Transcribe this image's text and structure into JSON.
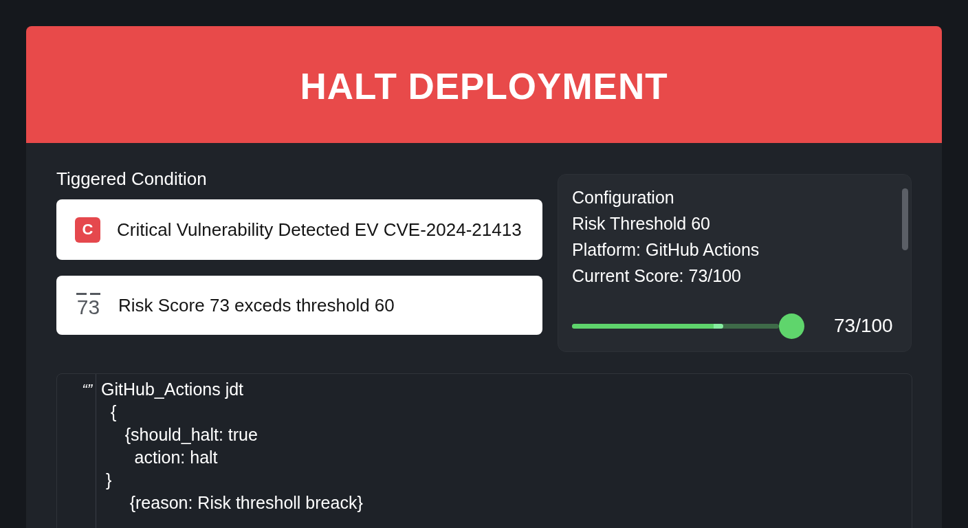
{
  "banner": {
    "title": "HALT DEPLOYMENT"
  },
  "triggered": {
    "heading": "Tiggered Condition",
    "conditions": [
      {
        "kind": "badge",
        "icon_text": "C",
        "text": "Critical Vulnerability Detected EV CVE-2024-21413"
      },
      {
        "kind": "score",
        "icon_text": "73",
        "text": "Risk Score 73 exceds threshold 60"
      }
    ]
  },
  "configuration": {
    "title": "Configuration",
    "lines": [
      "Risk Threshold 60",
      "Platform: GitHub Actions",
      "Current Score: 73/100"
    ],
    "slider": {
      "level": 0.73,
      "reading": "73/100"
    }
  },
  "code": {
    "gutter_mark": "“”",
    "lines": [
      "GitHub_Actions jdt",
      "  {",
      "     {should_halt: true",
      "       action: halt",
      " }",
      "      {reason: Risk thresholl breack}"
    ]
  }
}
